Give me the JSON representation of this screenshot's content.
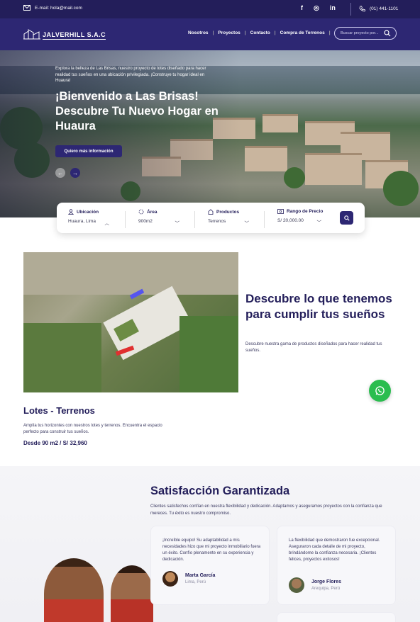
{
  "topbar": {
    "email": "E-mail: hola@mail.com",
    "social": [
      "f",
      "◎",
      "in"
    ],
    "phone": "(01) 441-1101"
  },
  "nav": {
    "brand": "JALVERHILL S.A.C",
    "menu": [
      "Nosotros",
      "Proyectos",
      "Contacto",
      "Compra de Terrenos"
    ],
    "search_placeholder": "Buscar proyecto por..."
  },
  "hero": {
    "intro": "Explora la belleza de Las Brisas, nuestro proyecto de lotes diseñado para hacer realidad tus sueños en una ubicación privilegiada. ¡Construye tu hogar ideal en Huaura!",
    "title": "¡Bienvenido a Las Brisas! Descubre Tu Nuevo Hogar en Huaura",
    "cta": "Quiero más información"
  },
  "filters": [
    {
      "label": "Ubicación",
      "value": "Huaura, Lima",
      "icon": "user-location-icon"
    },
    {
      "label": "Área",
      "value": "900m2",
      "icon": "area-icon"
    },
    {
      "label": "Productos",
      "value": "Terrenos",
      "icon": "home-icon"
    },
    {
      "label": "Rango de Precio",
      "value": "S/ 20,000.00",
      "icon": "price-icon"
    }
  ],
  "feature": {
    "title": "Descubre lo que tenemos para cumplir tus sueños",
    "subtitle": "Descubre nuestra gama de productos diseñados para hacer realidad tus sueños."
  },
  "lots": {
    "title": "Lotes - Terrenos",
    "description": "Amplía tus horizontes con nuestros lotes y terrenos. Encuentra el espacio perfecto para construir tus sueños.",
    "price": "Desde  90 m2 / S/ 32,960"
  },
  "satisfaction": {
    "title": "Satisfacción Garantizada",
    "intro": "Clientes satisfechos confían en nuestra flexibilidad y dedicación. Adaptamos y aseguramos proyectos con la confianza que mereces. Tu éxito es nuestro compromiso.",
    "testimonials": [
      {
        "quote": "¡Increíble equipo! Su adaptabilidad a mis necesidades hizo que mi proyecto inmobiliario fuera un éxito. Confío plenamente en su experiencia y dedicación.",
        "name": "Marta García",
        "location": "Lima, Perú"
      },
      {
        "quote": "La flexibilidad que demostraron fue excepcional. Aseguraron cada detalle de mi proyecto, brindándome la confianza necesaria. ¡Clientes felices, proyectos exitosos!",
        "name": "Jorge Flores",
        "location": "Arequipa, Perú"
      }
    ]
  },
  "colors": {
    "primary": "#2d2773",
    "dark": "#231e5a",
    "whatsapp": "#2bbd4f"
  }
}
